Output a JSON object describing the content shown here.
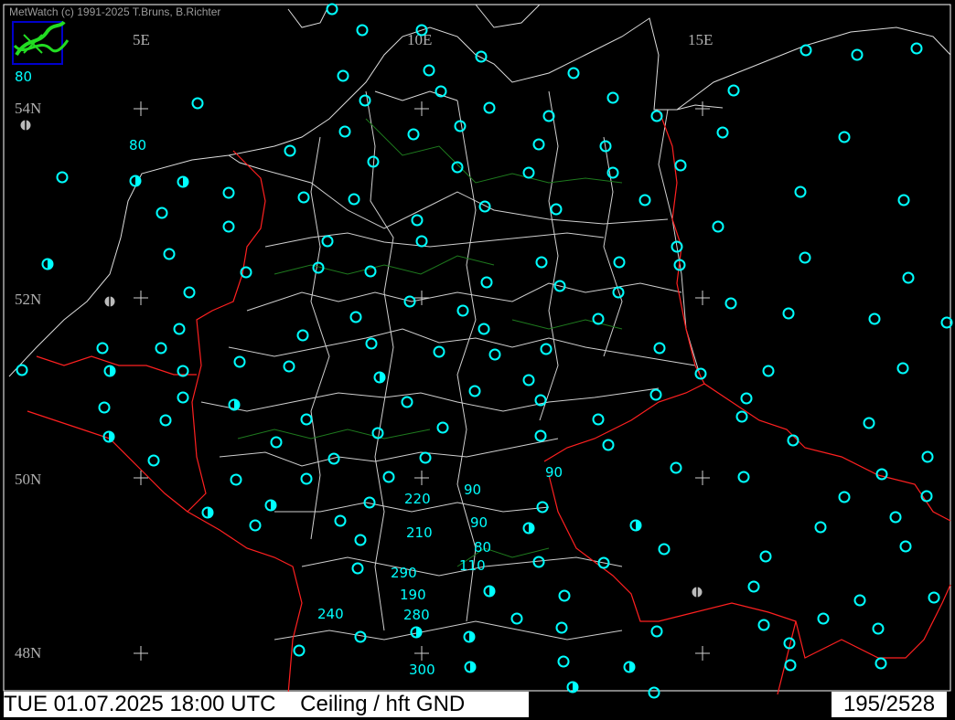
{
  "header": {
    "credit": "MetWatch  (c) 1991-2025 T.Bruns, B.Richter"
  },
  "status": {
    "label": "TUE 01.07.2025 18:00 UTC    Ceiling / hft GND",
    "counter": "195/2528"
  },
  "colors": {
    "background": "#000000",
    "station": "#00ffff",
    "station_unknown": "#bbbbbb",
    "country_border": "#ff2020",
    "admin_border": "#dcdcdc",
    "river": "#1e7a1e",
    "grid_label": "#b0b0b0"
  },
  "icons": [
    "metwatch-logo-icon",
    "station-clear-icon",
    "station-partial-icon",
    "station-missing-icon",
    "grid-cross-icon"
  ],
  "grid_labels": {
    "longitude": [
      "5E",
      "10E",
      "15E"
    ],
    "latitude": [
      "54N",
      "52N",
      "50N",
      "48N"
    ]
  },
  "ceiling_labels": [
    "80",
    "80",
    "90",
    "90",
    "220",
    "90",
    "210",
    "80",
    "110",
    "290",
    "190",
    "240",
    "280",
    "300"
  ]
}
